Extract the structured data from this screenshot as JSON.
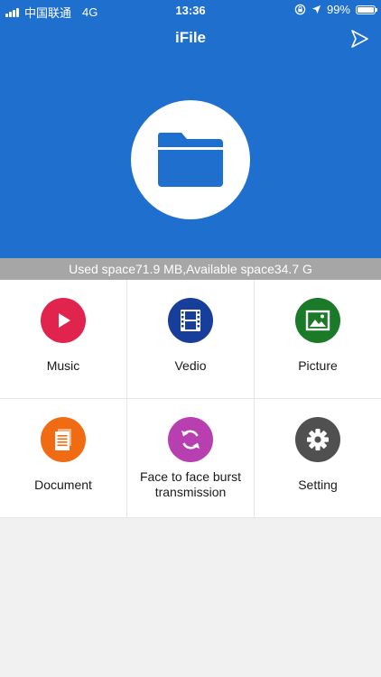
{
  "status_bar": {
    "carrier": "中国联通",
    "network": "4G",
    "time": "13:36",
    "battery": "99%",
    "battery_level": 0.99
  },
  "header": {
    "title": "iFile"
  },
  "storage": {
    "text": "Used space71.9 MB,Available space34.7 G"
  },
  "tiles": [
    {
      "label": "Music",
      "icon": "play-icon",
      "color": "#e0244e"
    },
    {
      "label": "Vedio",
      "icon": "film-icon",
      "color": "#173e9a"
    },
    {
      "label": "Picture",
      "icon": "picture-icon",
      "color": "#1a7a27"
    },
    {
      "label": "Document",
      "icon": "document-icon",
      "color": "#f06b12"
    },
    {
      "label": "Face to face burst transmission",
      "icon": "sync-icon",
      "color": "#b83fb0"
    },
    {
      "label": "Setting",
      "icon": "gear-icon",
      "color": "#505050"
    }
  ],
  "colors": {
    "header_bg": "#1e6fce",
    "storage_bg": "#a6a6a6",
    "page_bg": "#f1f1f1"
  }
}
